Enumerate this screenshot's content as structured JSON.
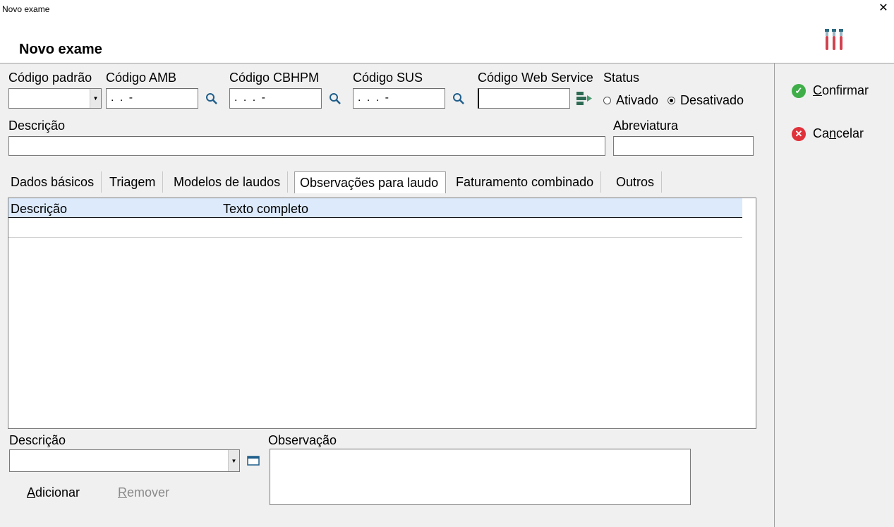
{
  "window": {
    "title": "Novo exame",
    "close_glyph": "✕"
  },
  "header": {
    "title": "Novo exame"
  },
  "fields": {
    "codigo_padrao": {
      "label": "Código padrão",
      "value": ""
    },
    "codigo_amb": {
      "label": "Código AMB",
      "value": ". .  -"
    },
    "codigo_cbhpm": {
      "label": "Código CBHPM",
      "value": ". . . -"
    },
    "codigo_sus": {
      "label": "Código SUS",
      "value": ". . .  -"
    },
    "codigo_web": {
      "label": "Código Web Service",
      "value": ""
    },
    "status": {
      "label": "Status",
      "options": [
        "Ativado",
        "Desativado"
      ],
      "selected": "Desativado"
    },
    "descricao": {
      "label": "Descrição",
      "value": ""
    },
    "abreviatura": {
      "label": "Abreviatura",
      "value": ""
    }
  },
  "tabs": [
    {
      "label": "Dados básicos"
    },
    {
      "label": "Triagem"
    },
    {
      "label": "Modelos de laudos"
    },
    {
      "label": "Observações para laudo"
    },
    {
      "label": "Faturamento combinado"
    },
    {
      "label": "Outros"
    }
  ],
  "active_tab": "Observações para laudo",
  "grid": {
    "columns": [
      "Descrição",
      "Texto completo"
    ],
    "rows": []
  },
  "bottom": {
    "descricao_label": "Descrição",
    "descricao_value": "",
    "observacao_label": "Observação",
    "observacao_value": "",
    "add": {
      "pre": "",
      "mn": "A",
      "post": "dicionar"
    },
    "remove": {
      "pre": "",
      "mn": "R",
      "post": "emover"
    }
  },
  "sidebar": {
    "confirm": {
      "pre": "",
      "mn": "C",
      "post": "onfirmar"
    },
    "cancel": {
      "pre": "Ca",
      "mn": "n",
      "post": "celar"
    }
  },
  "icons": {
    "search": "magnifier-icon",
    "web_service": "web-service-icon",
    "browse": "window-icon",
    "confirm": "check-circle-icon",
    "cancel": "x-circle-icon",
    "logo": "test-tubes-icon"
  },
  "colors": {
    "confirm": "#3fae49",
    "cancel": "#e0313b",
    "grid_header": "#dceafc",
    "magnifier": "#1f5e8a",
    "web_icon": "#2f6b54"
  }
}
